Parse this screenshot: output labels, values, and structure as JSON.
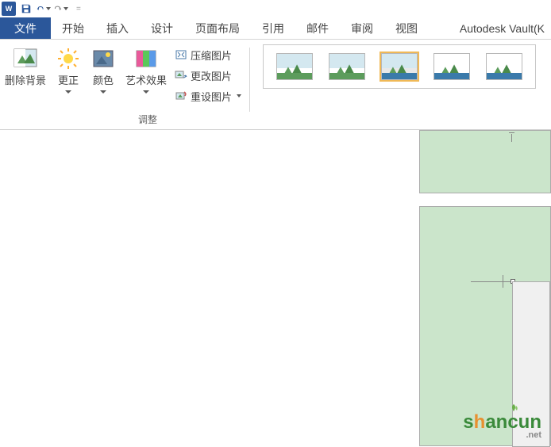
{
  "qat": {
    "appName": "W",
    "customize": "="
  },
  "tabs": {
    "file": "文件",
    "home": "开始",
    "insert": "插入",
    "design": "设计",
    "layout": "页面布局",
    "references": "引用",
    "mailings": "邮件",
    "review": "审阅",
    "view": "视图",
    "vault": "Autodesk Vault(K"
  },
  "ribbon": {
    "removeBg": "删除背景",
    "corrections": "更正",
    "color": "颜色",
    "artistic": "艺术效果",
    "compress": "压缩图片",
    "change": "更改图片",
    "reset": "重设图片",
    "adjustGroup": "调整"
  },
  "watermark": {
    "s": "s",
    "h": "h",
    "rest": "ancun",
    "net": ".net"
  }
}
